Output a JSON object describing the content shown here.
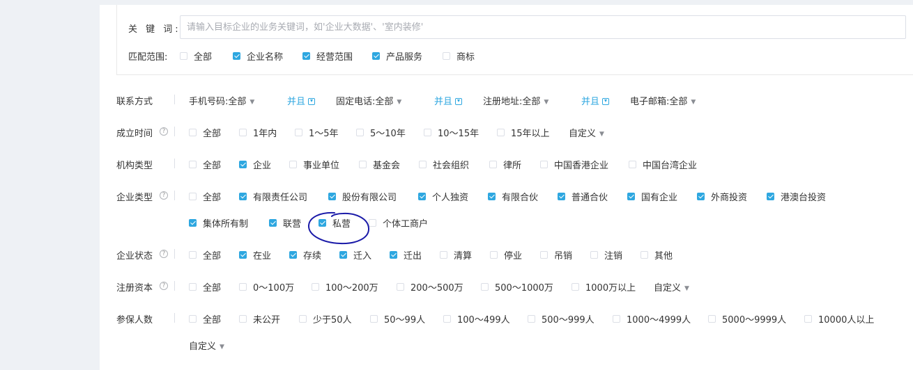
{
  "keyword": {
    "label": "关 键 词:",
    "placeholder": "请输入目标企业的业务关键词，如'企业大数据'、'室内装修'",
    "value": ""
  },
  "match": {
    "label": "匹配范围:",
    "options": [
      {
        "label": "全部",
        "checked": false
      },
      {
        "label": "企业名称",
        "checked": true
      },
      {
        "label": "经营范围",
        "checked": true
      },
      {
        "label": "产品服务",
        "checked": true
      },
      {
        "label": "商标",
        "checked": false
      }
    ]
  },
  "contact": {
    "label": "联系方式",
    "and_label": "并且",
    "items": [
      {
        "name": "手机号码:",
        "value": "全部"
      },
      {
        "name": "固定电话:",
        "value": "全部"
      },
      {
        "name": "注册地址:",
        "value": "全部"
      },
      {
        "name": "电子邮箱:",
        "value": "全部"
      }
    ]
  },
  "founded": {
    "label": "成立时间",
    "options": [
      {
        "label": "全部",
        "checked": false
      },
      {
        "label": "1年内",
        "checked": false
      },
      {
        "label": "1～5年",
        "checked": false
      },
      {
        "label": "5～10年",
        "checked": false
      },
      {
        "label": "10～15年",
        "checked": false
      },
      {
        "label": "15年以上",
        "checked": false
      }
    ],
    "custom": "自定义"
  },
  "org_type": {
    "label": "机构类型",
    "options": [
      {
        "label": "全部",
        "checked": false
      },
      {
        "label": "企业",
        "checked": true
      },
      {
        "label": "事业单位",
        "checked": false
      },
      {
        "label": "基金会",
        "checked": false
      },
      {
        "label": "社会组织",
        "checked": false
      },
      {
        "label": "律所",
        "checked": false
      },
      {
        "label": "中国香港企业",
        "checked": false
      },
      {
        "label": "中国台湾企业",
        "checked": false
      }
    ]
  },
  "ent_type": {
    "label": "企业类型",
    "options": [
      {
        "label": "全部",
        "checked": false
      },
      {
        "label": "有限责任公司",
        "checked": true
      },
      {
        "label": "股份有限公司",
        "checked": true
      },
      {
        "label": "个人独资",
        "checked": true
      },
      {
        "label": "有限合伙",
        "checked": true
      },
      {
        "label": "普通合伙",
        "checked": true
      },
      {
        "label": "国有企业",
        "checked": true
      },
      {
        "label": "外商投资",
        "checked": true
      },
      {
        "label": "港澳台投资",
        "checked": true
      },
      {
        "label": "集体所有制",
        "checked": true
      },
      {
        "label": "联营",
        "checked": true
      },
      {
        "label": "私营",
        "checked": true
      },
      {
        "label": "个体工商户",
        "checked": false
      }
    ]
  },
  "status": {
    "label": "企业状态",
    "options": [
      {
        "label": "全部",
        "checked": false
      },
      {
        "label": "在业",
        "checked": true
      },
      {
        "label": "存续",
        "checked": true
      },
      {
        "label": "迁入",
        "checked": true
      },
      {
        "label": "迁出",
        "checked": true
      },
      {
        "label": "清算",
        "checked": false
      },
      {
        "label": "停业",
        "checked": false
      },
      {
        "label": "吊销",
        "checked": false
      },
      {
        "label": "注销",
        "checked": false
      },
      {
        "label": "其他",
        "checked": false
      }
    ]
  },
  "capital": {
    "label": "注册资本",
    "options": [
      {
        "label": "全部",
        "checked": false
      },
      {
        "label": "0～100万",
        "checked": false
      },
      {
        "label": "100～200万",
        "checked": false
      },
      {
        "label": "200～500万",
        "checked": false
      },
      {
        "label": "500～1000万",
        "checked": false
      },
      {
        "label": "1000万以上",
        "checked": false
      }
    ],
    "custom": "自定义"
  },
  "insured": {
    "label": "参保人数",
    "options": [
      {
        "label": "全部",
        "checked": false
      },
      {
        "label": "未公开",
        "checked": false
      },
      {
        "label": "少于50人",
        "checked": false
      },
      {
        "label": "50～99人",
        "checked": false
      },
      {
        "label": "100～499人",
        "checked": false
      },
      {
        "label": "500～999人",
        "checked": false
      },
      {
        "label": "1000～4999人",
        "checked": false
      },
      {
        "label": "5000～9999人",
        "checked": false
      },
      {
        "label": "10000人以上",
        "checked": false
      }
    ],
    "custom": "自定义"
  },
  "help_glyph": "?",
  "caret_icon": "caret-down-icon",
  "accent_color": "#2ea7e0",
  "annotation_color": "#1a1aa8"
}
